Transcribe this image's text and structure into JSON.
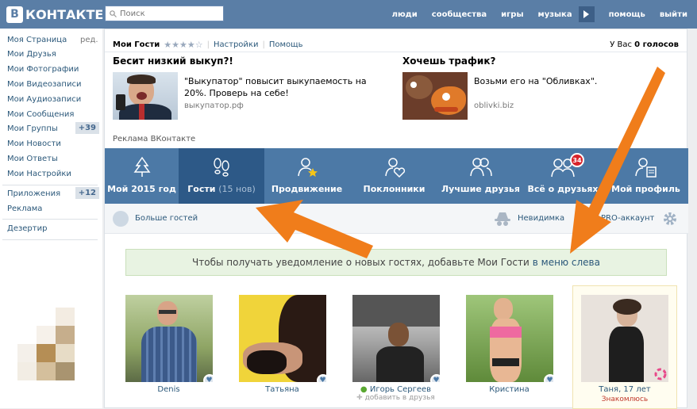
{
  "logo": {
    "mark": "В",
    "text": "КОНТАКТЕ"
  },
  "search": {
    "placeholder": "Поиск"
  },
  "topnav": [
    "люди",
    "сообщества",
    "игры",
    "музыка",
    "помощь",
    "выйти"
  ],
  "leftmenu": {
    "items": [
      "Моя Страница",
      "Мои Друзья",
      "Мои Фотографии",
      "Мои Видеозаписи",
      "Мои Аудиозаписи",
      "Мои Сообщения",
      "Мои Группы",
      "Мои Новости",
      "Мои Ответы",
      "Мои Настройки"
    ],
    "edit": "ред.",
    "groups_count": "+39",
    "apps": "Приложения",
    "apps_count": "+12",
    "ads": "Реклама",
    "deserter": "Дезертир"
  },
  "app": {
    "title": "Мои Гости",
    "settings": "Настройки",
    "help": "Помощь",
    "votes_prefix": "У Вас",
    "votes_value": "0 голосов"
  },
  "ads": [
    {
      "title": "Бесит низкий выкуп?!",
      "text": "\"Выкупатор\" повысит выкупаемость на 20%. Проверь на себе!",
      "domain": "выкупатор.рф"
    },
    {
      "title": "Хочешь трафик?",
      "text": "Возьми его на \"Обливках\".",
      "domain": "oblivki.biz"
    }
  ],
  "ads_label": "Реклама ВКонтакте",
  "tabs": [
    {
      "label": "Мой 2015 год",
      "sub": ""
    },
    {
      "label": "Гости",
      "sub": "(15 нов)"
    },
    {
      "label": "Продвижение",
      "sub": ""
    },
    {
      "label": "Поклонники",
      "sub": ""
    },
    {
      "label": "Лучшие друзья",
      "sub": ""
    },
    {
      "label": "Всё о друзьях",
      "sub": "",
      "badge": "34"
    },
    {
      "label": "Мой профиль",
      "sub": ""
    }
  ],
  "toolbar": {
    "more_guests": "Больше гостей",
    "invisible": "Невидимка",
    "pro": "PRO-аккаунт"
  },
  "notice": {
    "text": "Чтобы получать уведомление о новых гостях, добавьте Мои Гости",
    "link": "в меню слева"
  },
  "people": [
    {
      "name": "Denis",
      "extra": ""
    },
    {
      "name": "Татьяна",
      "extra": ""
    },
    {
      "name": "Игорь Сергеев",
      "extra": "добавить в друзья"
    },
    {
      "name": "Кристина",
      "extra": ""
    },
    {
      "name": "Таня, 17 лет",
      "extra": "Знакомлюсь"
    }
  ],
  "colors": {
    "brand": "#5a7ea6",
    "tab_bg": "#4c79a6",
    "tab_active": "#2d5987",
    "arrow": "#f07d1b",
    "link": "#2b587a"
  }
}
